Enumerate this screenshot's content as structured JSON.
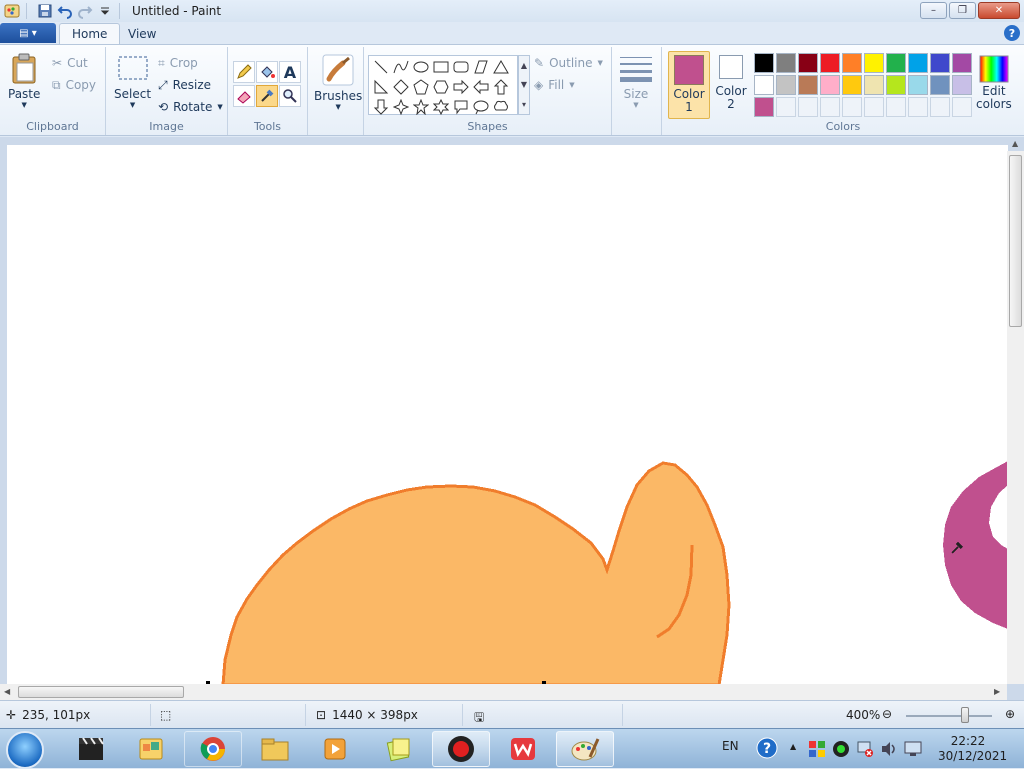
{
  "window": {
    "title": "Untitled - Paint",
    "minimize_label": "–",
    "maximize_label": "❐",
    "close_label": "✕"
  },
  "tabs": {
    "file_icon": "▤ ▾",
    "home": "Home",
    "view": "View",
    "help": "?"
  },
  "ribbon": {
    "clipboard": {
      "label": "Clipboard",
      "paste": "Paste",
      "cut": "Cut",
      "copy": "Copy"
    },
    "image": {
      "label": "Image",
      "select": "Select",
      "crop": "Crop",
      "resize": "Resize",
      "rotate": "Rotate"
    },
    "tools": {
      "label": "Tools"
    },
    "brushes": {
      "label": "Brushes"
    },
    "shapes": {
      "label": "Shapes",
      "outline": "Outline",
      "fill": "Fill"
    },
    "size": {
      "label": "Size"
    },
    "colors": {
      "label": "Colors",
      "color1_label": "Color",
      "color1_num": "1",
      "color2_label": "Color",
      "color2_num": "2",
      "edit_label": "Edit",
      "edit_label2": "colors",
      "color1": "#c0508e",
      "color2": "#ffffff",
      "palette_row1": [
        "#000000",
        "#7f7f7f",
        "#880015",
        "#ed1c24",
        "#ff7f27",
        "#fff200",
        "#22b14c",
        "#00a2e8",
        "#3f48cc",
        "#a349a4"
      ],
      "palette_row2": [
        "#ffffff",
        "#c3c3c3",
        "#b97a57",
        "#ffaec9",
        "#ffc90e",
        "#efe4b0",
        "#b5e61d",
        "#99d9ea",
        "#7092be",
        "#c8bfe7"
      ],
      "palette_row3": [
        "#c0508e"
      ]
    }
  },
  "canvas": {
    "orange_fill": "#fbb866",
    "orange_stroke": "#f07d2c",
    "pink_fill": "#c0508e"
  },
  "status": {
    "cursor_pos": "235, 101px",
    "image_size": "1440 × 398px",
    "zoom": "400%"
  },
  "taskbar": {
    "language": "EN",
    "time": "22:22",
    "date": "30/12/2021"
  }
}
